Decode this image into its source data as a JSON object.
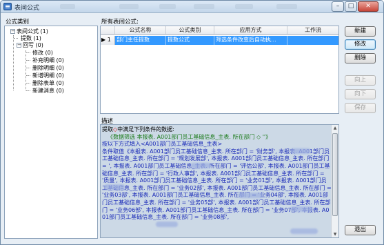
{
  "window": {
    "title": "表间公式",
    "controls": {
      "minimize": "–",
      "maximize": "□",
      "close": "✕"
    }
  },
  "left": {
    "header": "公式类别",
    "tree": {
      "root": "表间公式 (1)",
      "children": [
        {
          "label": "提数 (1)",
          "expander": ""
        },
        {
          "label": "回写 (0)",
          "expander": "−",
          "children": [
            "修改 (0)",
            "补充明细 (0)",
            "删除明细 (0)",
            "新增明细 (0)",
            "删除表单 (0)",
            "新建消息 (0)"
          ]
        }
      ],
      "root_expander": "−"
    }
  },
  "grid": {
    "header": "所有表间公式:",
    "columns": [
      "公式名称",
      "公式类别",
      "应用方式",
      "工作流"
    ],
    "rows": [
      {
        "indicator": "▶ 1",
        "name": "部门主任提数",
        "category": "提数公式",
        "apply": "筛选条件改变后自动执...",
        "workflow": ""
      }
    ]
  },
  "buttons": {
    "new": "新建",
    "edit": "修改",
    "delete": "删除",
    "up": "向上",
    "down": "向下",
    "save": "保存",
    "exit": "退出"
  },
  "description": {
    "header": "描述",
    "line1_a": "提取",
    "line1_mark": "◇",
    "line1_b": "中满足下列条件的数据:",
    "line2": "《数据筛选",
    "line2b": "本报表. A001部门员工基础信息_主表. 所在部门 ◇ ''》",
    "line3": "按以下方式填入<A001部门员工基础信息_主表>",
    "body": "条件取值《本报表. A001部门员工基础信息_主表. 所在部门 = '财务部', 本报表. A001部门员工基础信息_主表. 所在部门 = '规划发展部', 本报表. A001部门员工基础信息_主表. 所在部门 = ', 本报表. A001部门员工基础信息_主表. 所在部门 = '评估公部', 本报表. A001部门员工基础信息_主表. 所在部门 = '行政人事部', 本报表. A001部门员工基础信息_主表. 所在部门 = '质量', 本报表. A001部门员工基础信息_主表. 所在部门 = '业务01部', 本报表. A001部门员工基础信息_主表. 所在部门 = '业务02部', 本报表. A001部门员工基础信息_主表. 所在部门 = '业务03部', 本报表. A001部门员工基础信息_主表. 所在部门 = '业务04部', 本报表. A001部门员工基础信息_主表. 所在部门 = '业务05部', 本报表. A001部门员工基础信息_主表. 所在部门 = '业务06部', 本报表. A001部门员工基础信息_主表. 所在部门 = '业务07部', 本报表. A001部门员工基础信息_主表. 所在部门 = '业务08部',"
  }
}
